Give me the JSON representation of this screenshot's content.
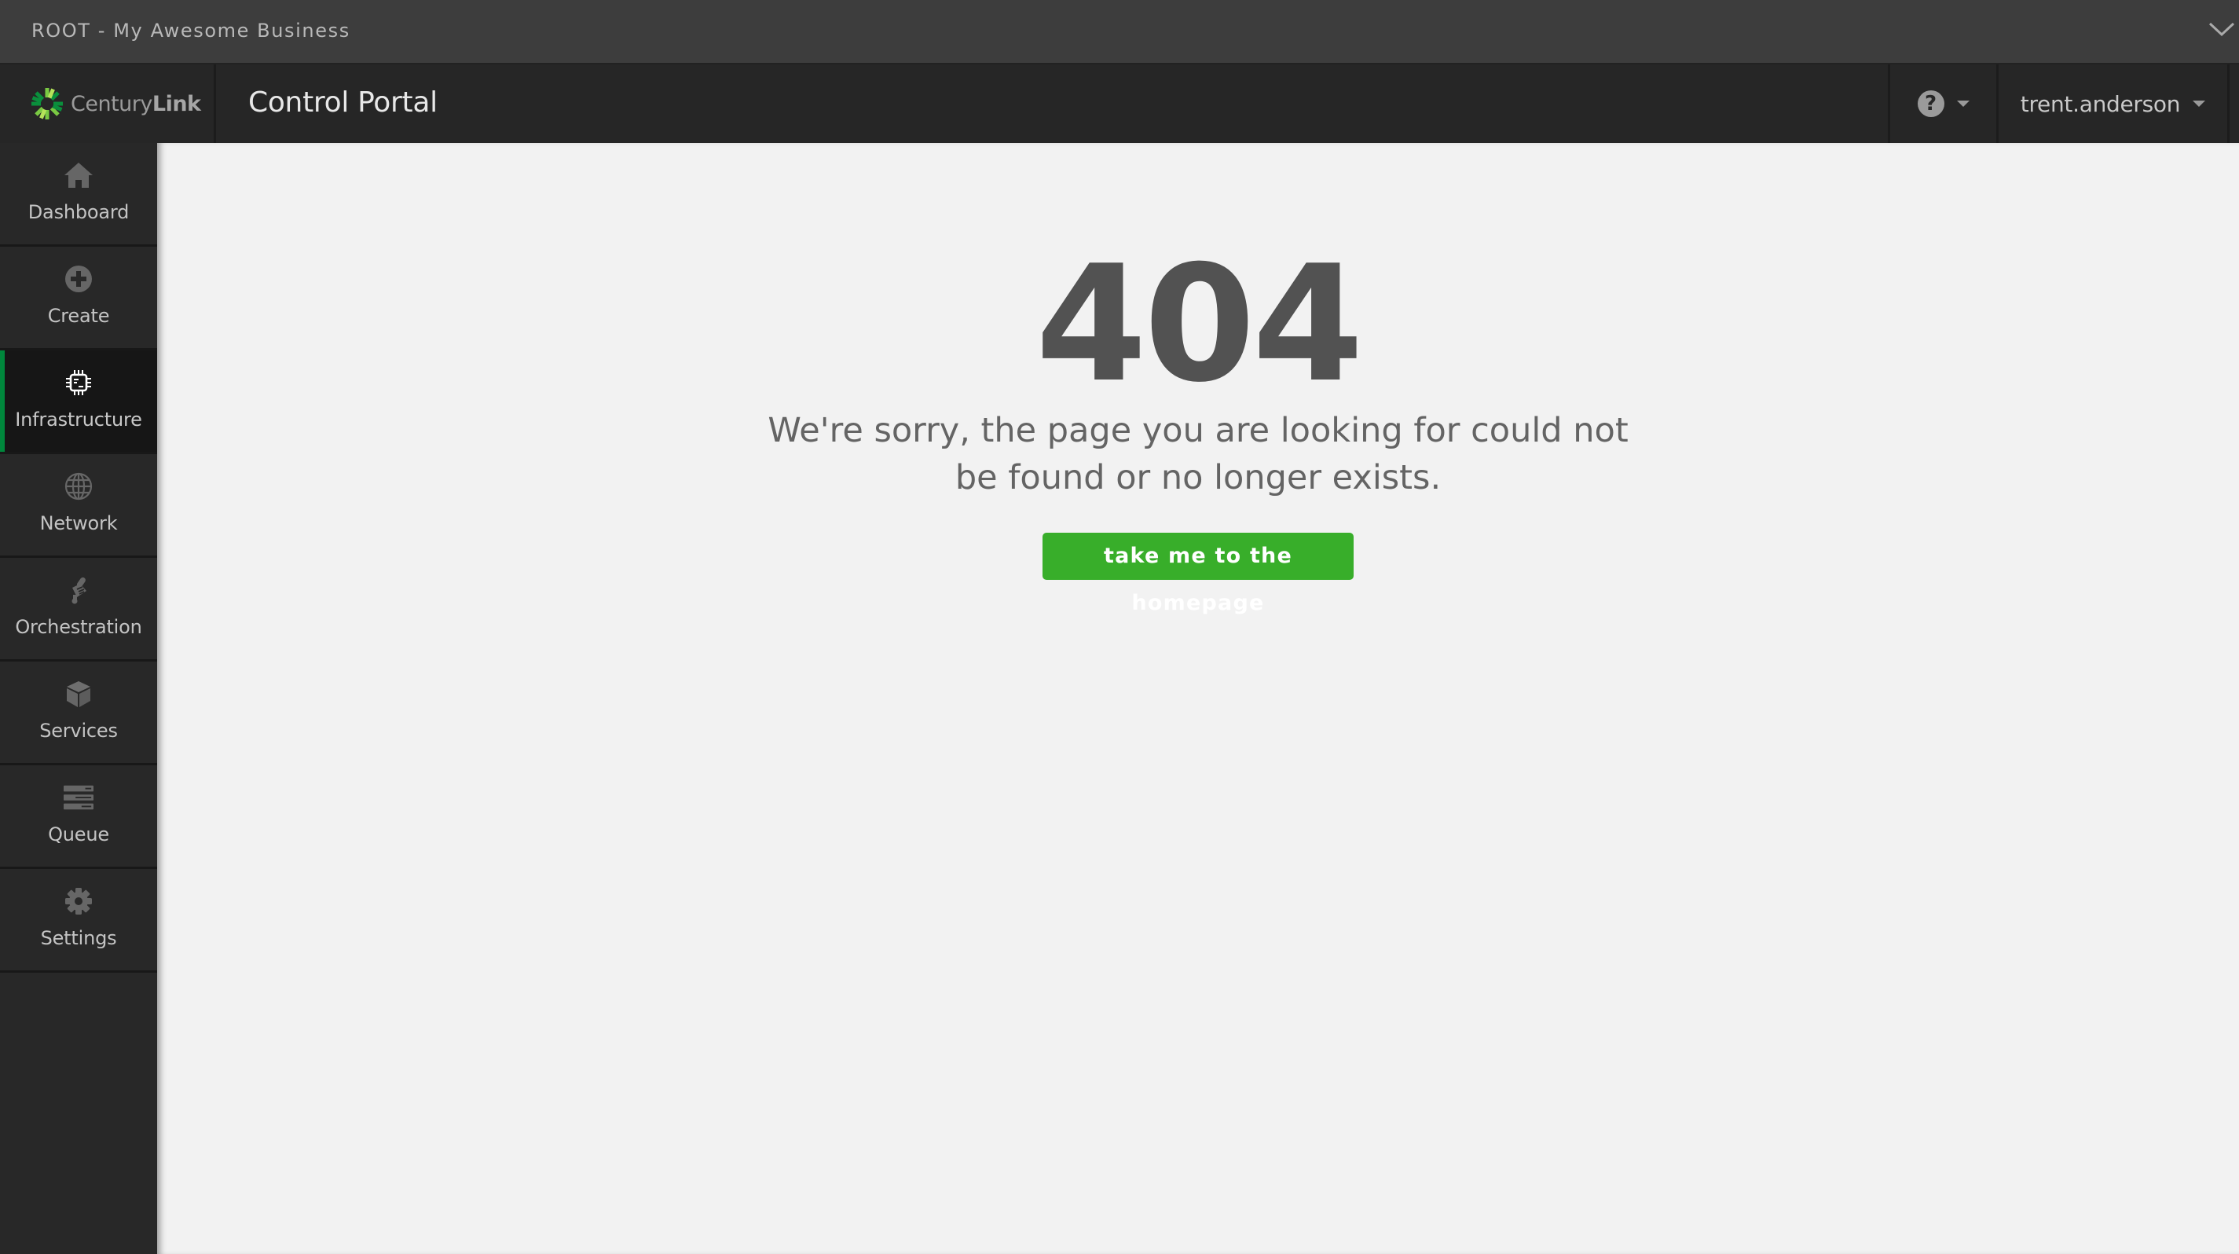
{
  "topbar": {
    "account_label": "ROOT - My Awesome Business",
    "expand_icon": "chevron-down-icon"
  },
  "header": {
    "brand_regular": "Century",
    "brand_bold": "Link",
    "app_title": "Control Portal",
    "help_icon": "question-circle-icon",
    "username": "trent.anderson"
  },
  "sidebar": {
    "items": [
      {
        "label": "Dashboard",
        "icon": "home-icon",
        "active": false
      },
      {
        "label": "Create",
        "icon": "plus-circle-icon",
        "active": false
      },
      {
        "label": "Infrastructure",
        "icon": "chip-icon",
        "active": true
      },
      {
        "label": "Network",
        "icon": "globe-icon",
        "active": false
      },
      {
        "label": "Orchestration",
        "icon": "scroll-icon",
        "active": false
      },
      {
        "label": "Services",
        "icon": "cube-icon",
        "active": false
      },
      {
        "label": "Queue",
        "icon": "server-stack-icon",
        "active": false
      },
      {
        "label": "Settings",
        "icon": "gear-icon",
        "active": false
      }
    ]
  },
  "error": {
    "code": "404",
    "message": "We're sorry, the page you are looking for could not be found or no longer exists.",
    "button_label": "take me to the homepage"
  },
  "colors": {
    "accent_green": "#38ae2a",
    "active_bar": "#00873c"
  }
}
